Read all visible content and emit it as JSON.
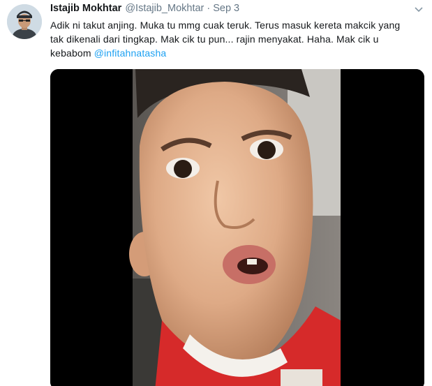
{
  "tweet": {
    "author": {
      "display_name": "Istajib Mokhtar",
      "handle": "@Istajib_Mokhtar"
    },
    "separator": "·",
    "timestamp": "Sep 3",
    "text_lines": [
      "Adik ni takut anjing. Muka tu mmg cuak teruk. Terus masuk kereta makcik yang",
      "tak dikenali dari tingkap. Mak cik tu pun... rajin menyakat. Haha. Mak cik u"
    ],
    "text_last_prefix": "kebabom ",
    "mention": "@infitahnatasha",
    "menu_icon": "chevron-down-icon",
    "media_type": "video"
  },
  "colors": {
    "link": "#1da1f2",
    "secondary_text": "#657786",
    "primary_text": "#14171a"
  }
}
